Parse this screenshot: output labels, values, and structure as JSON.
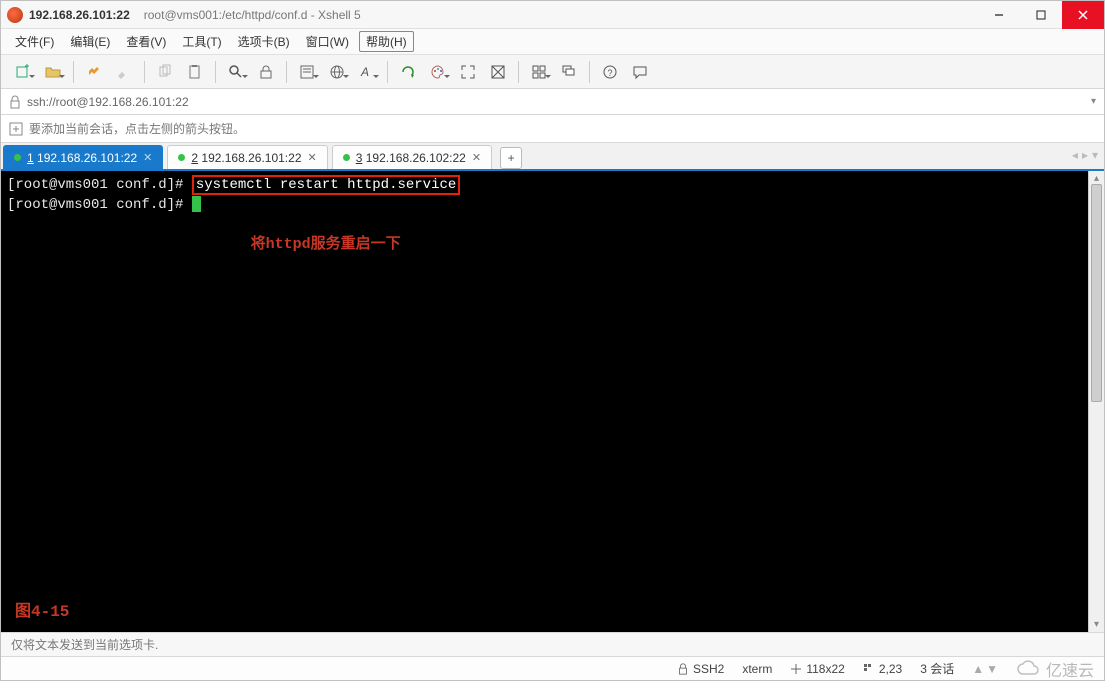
{
  "window": {
    "title_main": "192.168.26.101:22",
    "title_sub": "root@vms001:/etc/httpd/conf.d - Xshell 5"
  },
  "menu": {
    "file": "文件(F)",
    "edit": "编辑(E)",
    "view": "查看(V)",
    "tools": "工具(T)",
    "tabs": "选项卡(B)",
    "window": "窗口(W)",
    "help": "帮助(H)"
  },
  "toolbar_icons": {
    "new": "new-session-icon",
    "open": "open-folder-icon",
    "reconnect": "reconnect-icon",
    "highlight": "highlight-icon",
    "wand": "wand-icon",
    "copy": "copy-icon",
    "paste": "paste-icon",
    "search": "search-icon",
    "lock": "lock-screen-icon",
    "props": "properties-icon",
    "globe": "globe-icon",
    "font": "font-icon",
    "refresh": "refresh-icon",
    "palette": "palette-icon",
    "fullscreen": "fullscreen-icon",
    "transparent": "transparency-icon",
    "tile": "tile-icon",
    "cascade": "cascade-icon",
    "helpq": "help-icon",
    "chat": "chat-icon"
  },
  "address": {
    "url": "ssh://root@192.168.26.101:22"
  },
  "hint": "要添加当前会话，点击左侧的箭头按钮。",
  "tabs": [
    {
      "num": "1",
      "label": "192.168.26.101:22",
      "active": true
    },
    {
      "num": "2",
      "label": "192.168.26.101:22",
      "active": false
    },
    {
      "num": "3",
      "label": "192.168.26.102:22",
      "active": false
    }
  ],
  "terminal": {
    "prompt1": "[root@vms001 conf.d]# ",
    "command": "systemctl restart httpd.service",
    "prompt2": "[root@vms001 conf.d]# ",
    "annotation": "将httpd服务重启一下",
    "figure_label": "图4-15"
  },
  "footer_hint": "仅将文本发送到当前选项卡.",
  "status": {
    "proto": "SSH2",
    "term": "xterm",
    "size": "118x22",
    "pos": "2,23",
    "sessions": "3 会话"
  },
  "watermark": "亿速云"
}
